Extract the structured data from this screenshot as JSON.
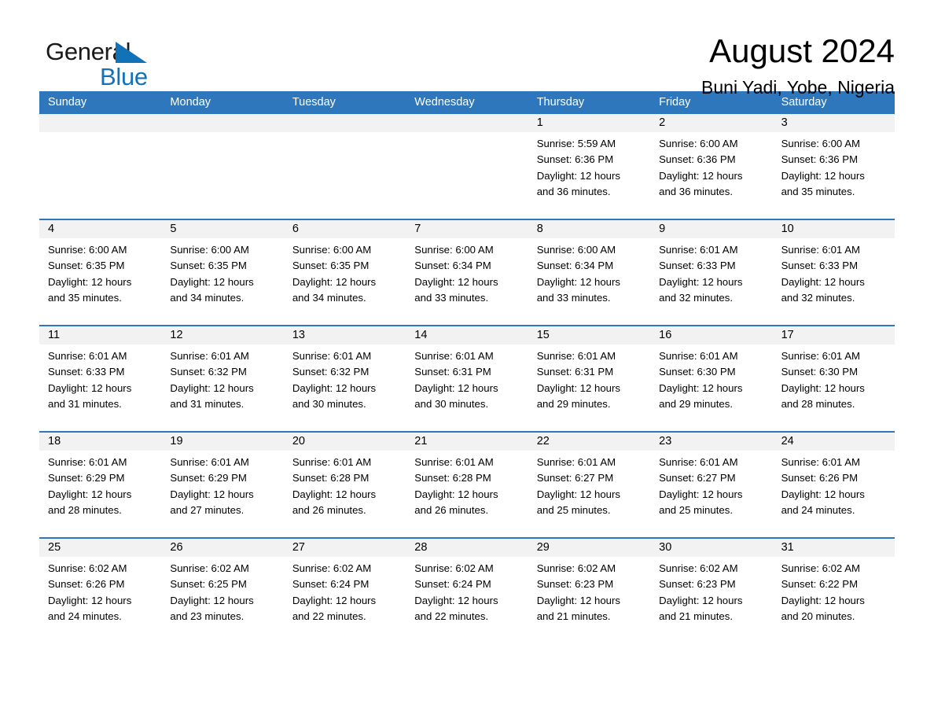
{
  "logo": {
    "word_one": "General",
    "word_two": "Blue",
    "triangle": "triangle-logo-mark",
    "brand_color": "#1272b8"
  },
  "header": {
    "title": "August 2024",
    "location": "Buni Yadi, Yobe, Nigeria"
  },
  "theme": {
    "header_blue": "#2e77bc",
    "day_strip_gray": "#f2f2f2",
    "text_black": "#000000"
  },
  "weekdays": [
    "Sunday",
    "Monday",
    "Tuesday",
    "Wednesday",
    "Thursday",
    "Friday",
    "Saturday"
  ],
  "weeks": [
    [
      {
        "day": "",
        "lines": []
      },
      {
        "day": "",
        "lines": []
      },
      {
        "day": "",
        "lines": []
      },
      {
        "day": "",
        "lines": []
      },
      {
        "day": "1",
        "lines": [
          "Sunrise: 5:59 AM",
          "Sunset: 6:36 PM",
          "Daylight: 12 hours",
          "and 36 minutes."
        ]
      },
      {
        "day": "2",
        "lines": [
          "Sunrise: 6:00 AM",
          "Sunset: 6:36 PM",
          "Daylight: 12 hours",
          "and 36 minutes."
        ]
      },
      {
        "day": "3",
        "lines": [
          "Sunrise: 6:00 AM",
          "Sunset: 6:36 PM",
          "Daylight: 12 hours",
          "and 35 minutes."
        ]
      }
    ],
    [
      {
        "day": "4",
        "lines": [
          "Sunrise: 6:00 AM",
          "Sunset: 6:35 PM",
          "Daylight: 12 hours",
          "and 35 minutes."
        ]
      },
      {
        "day": "5",
        "lines": [
          "Sunrise: 6:00 AM",
          "Sunset: 6:35 PM",
          "Daylight: 12 hours",
          "and 34 minutes."
        ]
      },
      {
        "day": "6",
        "lines": [
          "Sunrise: 6:00 AM",
          "Sunset: 6:35 PM",
          "Daylight: 12 hours",
          "and 34 minutes."
        ]
      },
      {
        "day": "7",
        "lines": [
          "Sunrise: 6:00 AM",
          "Sunset: 6:34 PM",
          "Daylight: 12 hours",
          "and 33 minutes."
        ]
      },
      {
        "day": "8",
        "lines": [
          "Sunrise: 6:00 AM",
          "Sunset: 6:34 PM",
          "Daylight: 12 hours",
          "and 33 minutes."
        ]
      },
      {
        "day": "9",
        "lines": [
          "Sunrise: 6:01 AM",
          "Sunset: 6:33 PM",
          "Daylight: 12 hours",
          "and 32 minutes."
        ]
      },
      {
        "day": "10",
        "lines": [
          "Sunrise: 6:01 AM",
          "Sunset: 6:33 PM",
          "Daylight: 12 hours",
          "and 32 minutes."
        ]
      }
    ],
    [
      {
        "day": "11",
        "lines": [
          "Sunrise: 6:01 AM",
          "Sunset: 6:33 PM",
          "Daylight: 12 hours",
          "and 31 minutes."
        ]
      },
      {
        "day": "12",
        "lines": [
          "Sunrise: 6:01 AM",
          "Sunset: 6:32 PM",
          "Daylight: 12 hours",
          "and 31 minutes."
        ]
      },
      {
        "day": "13",
        "lines": [
          "Sunrise: 6:01 AM",
          "Sunset: 6:32 PM",
          "Daylight: 12 hours",
          "and 30 minutes."
        ]
      },
      {
        "day": "14",
        "lines": [
          "Sunrise: 6:01 AM",
          "Sunset: 6:31 PM",
          "Daylight: 12 hours",
          "and 30 minutes."
        ]
      },
      {
        "day": "15",
        "lines": [
          "Sunrise: 6:01 AM",
          "Sunset: 6:31 PM",
          "Daylight: 12 hours",
          "and 29 minutes."
        ]
      },
      {
        "day": "16",
        "lines": [
          "Sunrise: 6:01 AM",
          "Sunset: 6:30 PM",
          "Daylight: 12 hours",
          "and 29 minutes."
        ]
      },
      {
        "day": "17",
        "lines": [
          "Sunrise: 6:01 AM",
          "Sunset: 6:30 PM",
          "Daylight: 12 hours",
          "and 28 minutes."
        ]
      }
    ],
    [
      {
        "day": "18",
        "lines": [
          "Sunrise: 6:01 AM",
          "Sunset: 6:29 PM",
          "Daylight: 12 hours",
          "and 28 minutes."
        ]
      },
      {
        "day": "19",
        "lines": [
          "Sunrise: 6:01 AM",
          "Sunset: 6:29 PM",
          "Daylight: 12 hours",
          "and 27 minutes."
        ]
      },
      {
        "day": "20",
        "lines": [
          "Sunrise: 6:01 AM",
          "Sunset: 6:28 PM",
          "Daylight: 12 hours",
          "and 26 minutes."
        ]
      },
      {
        "day": "21",
        "lines": [
          "Sunrise: 6:01 AM",
          "Sunset: 6:28 PM",
          "Daylight: 12 hours",
          "and 26 minutes."
        ]
      },
      {
        "day": "22",
        "lines": [
          "Sunrise: 6:01 AM",
          "Sunset: 6:27 PM",
          "Daylight: 12 hours",
          "and 25 minutes."
        ]
      },
      {
        "day": "23",
        "lines": [
          "Sunrise: 6:01 AM",
          "Sunset: 6:27 PM",
          "Daylight: 12 hours",
          "and 25 minutes."
        ]
      },
      {
        "day": "24",
        "lines": [
          "Sunrise: 6:01 AM",
          "Sunset: 6:26 PM",
          "Daylight: 12 hours",
          "and 24 minutes."
        ]
      }
    ],
    [
      {
        "day": "25",
        "lines": [
          "Sunrise: 6:02 AM",
          "Sunset: 6:26 PM",
          "Daylight: 12 hours",
          "and 24 minutes."
        ]
      },
      {
        "day": "26",
        "lines": [
          "Sunrise: 6:02 AM",
          "Sunset: 6:25 PM",
          "Daylight: 12 hours",
          "and 23 minutes."
        ]
      },
      {
        "day": "27",
        "lines": [
          "Sunrise: 6:02 AM",
          "Sunset: 6:24 PM",
          "Daylight: 12 hours",
          "and 22 minutes."
        ]
      },
      {
        "day": "28",
        "lines": [
          "Sunrise: 6:02 AM",
          "Sunset: 6:24 PM",
          "Daylight: 12 hours",
          "and 22 minutes."
        ]
      },
      {
        "day": "29",
        "lines": [
          "Sunrise: 6:02 AM",
          "Sunset: 6:23 PM",
          "Daylight: 12 hours",
          "and 21 minutes."
        ]
      },
      {
        "day": "30",
        "lines": [
          "Sunrise: 6:02 AM",
          "Sunset: 6:23 PM",
          "Daylight: 12 hours",
          "and 21 minutes."
        ]
      },
      {
        "day": "31",
        "lines": [
          "Sunrise: 6:02 AM",
          "Sunset: 6:22 PM",
          "Daylight: 12 hours",
          "and 20 minutes."
        ]
      }
    ]
  ]
}
